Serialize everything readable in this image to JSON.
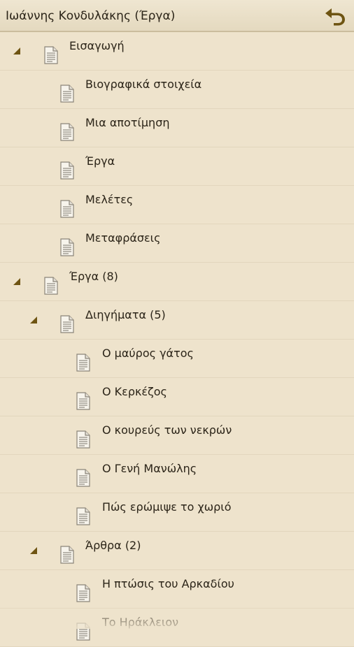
{
  "header": {
    "title": "Ιωάννης Κονδυλάκης (Έργα)",
    "back_icon": "back-arrow-icon"
  },
  "colors": {
    "background": "#eee3cc",
    "accent": "#6e5412",
    "divider": "#e2d6bd"
  },
  "tree": [
    {
      "label": "Εισαγωγή",
      "level": 0,
      "expandable": true
    },
    {
      "label": "Βιογραφικά στοιχεία",
      "level": 1,
      "expandable": false
    },
    {
      "label": "Μια αποτίμηση",
      "level": 1,
      "expandable": false
    },
    {
      "label": "Έργα",
      "level": 1,
      "expandable": false
    },
    {
      "label": "Μελέτες",
      "level": 1,
      "expandable": false
    },
    {
      "label": "Μεταφράσεις",
      "level": 1,
      "expandable": false
    },
    {
      "label": "Έργα (8)",
      "level": 0,
      "expandable": true
    },
    {
      "label": "Διηγήματα (5)",
      "level": 1,
      "expandable": true
    },
    {
      "label": "Ο μαύρος γάτος",
      "level": 2,
      "expandable": false
    },
    {
      "label": "Ο Κερκέζος",
      "level": 2,
      "expandable": false
    },
    {
      "label": "Ο κουρεύς των νεκρών",
      "level": 2,
      "expandable": false
    },
    {
      "label": "Ο Γενή Μανώλης",
      "level": 2,
      "expandable": false
    },
    {
      "label": "Πώς ερώμιψε το χωριό",
      "level": 2,
      "expandable": false
    },
    {
      "label": "Άρθρα (2)",
      "level": 1,
      "expandable": true
    },
    {
      "label": "Η πτώσις του Αρκαδίου",
      "level": 2,
      "expandable": false
    },
    {
      "label": "Το Ηράκλειον",
      "level": 2,
      "expandable": false
    }
  ]
}
